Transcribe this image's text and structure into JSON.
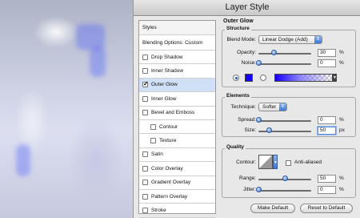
{
  "window": {
    "title": "Layer Style"
  },
  "styles_list": {
    "header": "Styles",
    "blending": "Blending Options: Custom",
    "items": [
      {
        "label": "Drop Shadow",
        "checked": false,
        "sub": false,
        "selected": false
      },
      {
        "label": "Inner Shadow",
        "checked": false,
        "sub": false,
        "selected": false
      },
      {
        "label": "Outer Glow",
        "checked": true,
        "sub": false,
        "selected": true
      },
      {
        "label": "Inner Glow",
        "checked": false,
        "sub": false,
        "selected": false
      },
      {
        "label": "Bevel and Emboss",
        "checked": false,
        "sub": false,
        "selected": false
      },
      {
        "label": "Contour",
        "checked": false,
        "sub": true,
        "selected": false
      },
      {
        "label": "Texture",
        "checked": false,
        "sub": true,
        "selected": false
      },
      {
        "label": "Satin",
        "checked": false,
        "sub": false,
        "selected": false
      },
      {
        "label": "Color Overlay",
        "checked": false,
        "sub": false,
        "selected": false
      },
      {
        "label": "Gradient Overlay",
        "checked": false,
        "sub": false,
        "selected": false
      },
      {
        "label": "Pattern Overlay",
        "checked": false,
        "sub": false,
        "selected": false
      },
      {
        "label": "Stroke",
        "checked": false,
        "sub": false,
        "selected": false
      }
    ]
  },
  "outer_glow": {
    "title": "Outer Glow",
    "structure": {
      "title": "Structure",
      "blend_mode_label": "Blend Mode:",
      "blend_mode_value": "Linear Dodge (Add)",
      "opacity_label": "Opacity:",
      "opacity_value": "30",
      "opacity_fraction": 0.3,
      "opacity_unit": "%",
      "noise_label": "Noise:",
      "noise_value": "0",
      "noise_fraction": 0.0,
      "noise_unit": "%",
      "glow_color": "#1400ff"
    },
    "elements": {
      "title": "Elements",
      "technique_label": "Technique:",
      "technique_value": "Softer",
      "spread_label": "Spread:",
      "spread_value": "0",
      "spread_fraction": 0.0,
      "spread_unit": "%",
      "size_label": "Size:",
      "size_value": "50",
      "size_fraction": 0.2,
      "size_unit": "px"
    },
    "quality": {
      "title": "Quality",
      "contour_label": "Contour:",
      "anti_aliased_label": "Anti-aliased",
      "anti_aliased_checked": false,
      "range_label": "Range:",
      "range_value": "50",
      "range_fraction": 0.5,
      "range_unit": "%",
      "jitter_label": "Jitter:",
      "jitter_value": "0",
      "jitter_fraction": 0.0,
      "jitter_unit": "%"
    },
    "buttons": {
      "make_default": "Make Default",
      "reset_default": "Reset to Default"
    }
  }
}
